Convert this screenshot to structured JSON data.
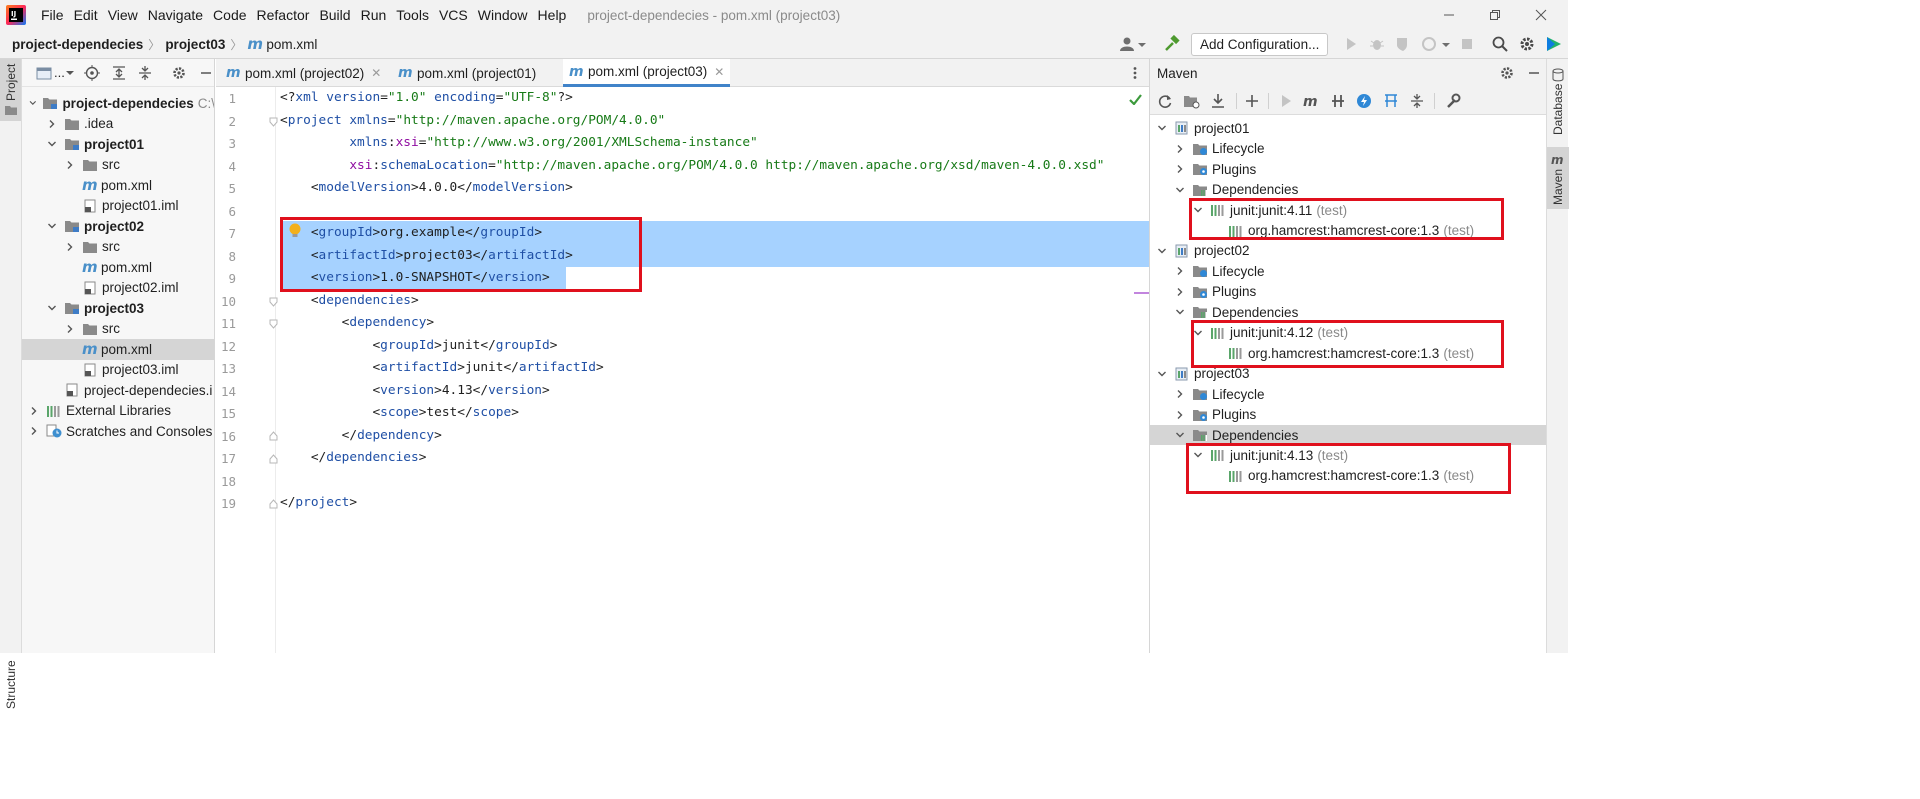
{
  "menubar": {
    "items": [
      "File",
      "Edit",
      "View",
      "Navigate",
      "Code",
      "Refactor",
      "Build",
      "Run",
      "Tools",
      "VCS",
      "Window",
      "Help"
    ],
    "window_title": "project-dependecies - pom.xml (project03)"
  },
  "navbar": {
    "crumbs": [
      "project-dependecies",
      "project03",
      "pom.xml"
    ],
    "run_config_label": "Add Configuration..."
  },
  "left_stripe": {
    "project_label": "Project",
    "structure_label": "Structure"
  },
  "project_panel": {
    "header_label": "...",
    "tree": [
      {
        "label": "project-dependecies",
        "hint": "C:\\",
        "bold": true,
        "level": 0,
        "arrow": "down",
        "icon": "module-folder"
      },
      {
        "label": ".idea",
        "level": 1,
        "arrow": "right",
        "icon": "folder"
      },
      {
        "label": "project01",
        "bold": true,
        "level": 1,
        "arrow": "down",
        "icon": "module-folder"
      },
      {
        "label": "src",
        "level": 2,
        "arrow": "right",
        "icon": "folder"
      },
      {
        "label": "pom.xml",
        "level": 2,
        "arrow": "none",
        "icon": "maven-m"
      },
      {
        "label": "project01.iml",
        "level": 2,
        "arrow": "none",
        "icon": "iml-file"
      },
      {
        "label": "project02",
        "bold": true,
        "level": 1,
        "arrow": "down",
        "icon": "module-folder"
      },
      {
        "label": "src",
        "level": 2,
        "arrow": "right",
        "icon": "folder"
      },
      {
        "label": "pom.xml",
        "level": 2,
        "arrow": "none",
        "icon": "maven-m"
      },
      {
        "label": "project02.iml",
        "level": 2,
        "arrow": "none",
        "icon": "iml-file"
      },
      {
        "label": "project03",
        "bold": true,
        "level": 1,
        "arrow": "down",
        "icon": "module-folder"
      },
      {
        "label": "src",
        "level": 2,
        "arrow": "right",
        "icon": "folder"
      },
      {
        "label": "pom.xml",
        "level": 2,
        "arrow": "none",
        "icon": "maven-m",
        "selected": true
      },
      {
        "label": "project03.iml",
        "level": 2,
        "arrow": "none",
        "icon": "iml-file"
      },
      {
        "label": "project-dependecies.i",
        "level": 1,
        "arrow": "none",
        "icon": "iml-file"
      },
      {
        "label": "External Libraries",
        "level": 0,
        "arrow": "right",
        "icon": "library"
      },
      {
        "label": "Scratches and Consoles",
        "level": 0,
        "arrow": "right",
        "icon": "scratch"
      }
    ]
  },
  "editor": {
    "tabs": [
      {
        "label": "pom.xml (project02)",
        "active": false
      },
      {
        "label": "pom.xml (project01)",
        "active": false
      },
      {
        "label": "pom.xml (project03)",
        "active": true
      }
    ],
    "line_numbers": [
      "1",
      "2",
      "3",
      "4",
      "5",
      "6",
      "7",
      "8",
      "9",
      "10",
      "11",
      "12",
      "13",
      "14",
      "15",
      "16",
      "17",
      "18",
      "19"
    ],
    "lines": [
      [
        [
          "br",
          "<?"
        ],
        [
          "tag",
          "xml "
        ],
        [
          "attr",
          "version"
        ],
        [
          "br",
          "="
        ],
        [
          "val",
          "\"1.0\" "
        ],
        [
          "attr",
          "encoding"
        ],
        [
          "br",
          "="
        ],
        [
          "val",
          "\"UTF-8\""
        ],
        [
          "br",
          "?>"
        ]
      ],
      [
        [
          "br",
          "<"
        ],
        [
          "tag",
          "project "
        ],
        [
          "attr",
          "xmlns"
        ],
        [
          "br",
          "="
        ],
        [
          "val",
          "\"http://maven.apache.org/POM/4.0.0\""
        ]
      ],
      [
        [
          "txt",
          "         "
        ],
        [
          "attr",
          "xmlns"
        ],
        [
          "br",
          ":"
        ],
        [
          "ns",
          "xsi"
        ],
        [
          "br",
          "="
        ],
        [
          "val",
          "\"http://www.w3.org/2001/XMLSchema-instance\""
        ]
      ],
      [
        [
          "txt",
          "         "
        ],
        [
          "ns",
          "xsi"
        ],
        [
          "br",
          ":"
        ],
        [
          "attr",
          "schemaLocation"
        ],
        [
          "br",
          "="
        ],
        [
          "val",
          "\"http://maven.apache.org/POM/4.0.0 http://maven.apache.org/xsd/maven-4.0.0.xsd\""
        ]
      ],
      [
        [
          "txt",
          "    "
        ],
        [
          "br",
          "<"
        ],
        [
          "tag",
          "modelVersion"
        ],
        [
          "br",
          ">"
        ],
        [
          "txt",
          "4.0.0"
        ],
        [
          "br",
          "</"
        ],
        [
          "tag",
          "modelVersion"
        ],
        [
          "br",
          ">"
        ]
      ],
      [],
      [
        [
          "txt",
          "    "
        ],
        [
          "br",
          "<"
        ],
        [
          "tag",
          "groupId"
        ],
        [
          "br",
          ">"
        ],
        [
          "txt",
          "org.example"
        ],
        [
          "br",
          "</"
        ],
        [
          "tag",
          "groupId"
        ],
        [
          "br",
          ">"
        ]
      ],
      [
        [
          "txt",
          "    "
        ],
        [
          "br",
          "<"
        ],
        [
          "tag",
          "artifactId"
        ],
        [
          "br",
          ">"
        ],
        [
          "txt",
          "project03"
        ],
        [
          "br",
          "</"
        ],
        [
          "tag",
          "artifactId"
        ],
        [
          "br",
          ">"
        ]
      ],
      [
        [
          "txt",
          "    "
        ],
        [
          "br",
          "<"
        ],
        [
          "tag",
          "version"
        ],
        [
          "br",
          ">"
        ],
        [
          "txt",
          "1.0-SNAPSHOT"
        ],
        [
          "br",
          "</"
        ],
        [
          "tag",
          "version"
        ],
        [
          "br",
          ">"
        ]
      ],
      [
        [
          "txt",
          "    "
        ],
        [
          "br",
          "<"
        ],
        [
          "tag",
          "dependencies"
        ],
        [
          "br",
          ">"
        ]
      ],
      [
        [
          "txt",
          "        "
        ],
        [
          "br",
          "<"
        ],
        [
          "tag",
          "dependency"
        ],
        [
          "br",
          ">"
        ]
      ],
      [
        [
          "txt",
          "            "
        ],
        [
          "br",
          "<"
        ],
        [
          "tag",
          "groupId"
        ],
        [
          "br",
          ">"
        ],
        [
          "txt",
          "junit"
        ],
        [
          "br",
          "</"
        ],
        [
          "tag",
          "groupId"
        ],
        [
          "br",
          ">"
        ]
      ],
      [
        [
          "txt",
          "            "
        ],
        [
          "br",
          "<"
        ],
        [
          "tag",
          "artifactId"
        ],
        [
          "br",
          ">"
        ],
        [
          "txt",
          "junit"
        ],
        [
          "br",
          "</"
        ],
        [
          "tag",
          "artifactId"
        ],
        [
          "br",
          ">"
        ]
      ],
      [
        [
          "txt",
          "            "
        ],
        [
          "br",
          "<"
        ],
        [
          "tag",
          "version"
        ],
        [
          "br",
          ">"
        ],
        [
          "txt",
          "4.13"
        ],
        [
          "br",
          "</"
        ],
        [
          "tag",
          "version"
        ],
        [
          "br",
          ">"
        ]
      ],
      [
        [
          "txt",
          "            "
        ],
        [
          "br",
          "<"
        ],
        [
          "tag",
          "scope"
        ],
        [
          "br",
          ">"
        ],
        [
          "txt",
          "test"
        ],
        [
          "br",
          "</"
        ],
        [
          "tag",
          "scope"
        ],
        [
          "br",
          ">"
        ]
      ],
      [
        [
          "txt",
          "        "
        ],
        [
          "br",
          "</"
        ],
        [
          "tag",
          "dependency"
        ],
        [
          "br",
          ">"
        ]
      ],
      [
        [
          "txt",
          "    "
        ],
        [
          "br",
          "</"
        ],
        [
          "tag",
          "dependencies"
        ],
        [
          "br",
          ">"
        ]
      ],
      [],
      [
        [
          "br",
          "</"
        ],
        [
          "tag",
          "project"
        ],
        [
          "br",
          ">"
        ]
      ]
    ]
  },
  "maven": {
    "title": "Maven",
    "tree": [
      {
        "label": "project01",
        "level": 0,
        "arrow": "down",
        "icon": "maven-module"
      },
      {
        "label": "Lifecycle",
        "level": 1,
        "arrow": "right",
        "icon": "lifecycle"
      },
      {
        "label": "Plugins",
        "level": 1,
        "arrow": "right",
        "icon": "plugins"
      },
      {
        "label": "Dependencies",
        "level": 1,
        "arrow": "down",
        "icon": "deps"
      },
      {
        "label": "junit:junit:4.11",
        "scope": "(test)",
        "level": 2,
        "arrow": "down",
        "icon": "lib"
      },
      {
        "label": "org.hamcrest:hamcrest-core:1.3",
        "scope": "(test)",
        "level": 3,
        "arrow": "none",
        "icon": "lib"
      },
      {
        "label": "project02",
        "level": 0,
        "arrow": "down",
        "icon": "maven-module"
      },
      {
        "label": "Lifecycle",
        "level": 1,
        "arrow": "right",
        "icon": "lifecycle"
      },
      {
        "label": "Plugins",
        "level": 1,
        "arrow": "right",
        "icon": "plugins"
      },
      {
        "label": "Dependencies",
        "level": 1,
        "arrow": "down",
        "icon": "deps"
      },
      {
        "label": "junit:junit:4.12",
        "scope": "(test)",
        "level": 2,
        "arrow": "down",
        "icon": "lib"
      },
      {
        "label": "org.hamcrest:hamcrest-core:1.3",
        "scope": "(test)",
        "level": 3,
        "arrow": "none",
        "icon": "lib"
      },
      {
        "label": "project03",
        "level": 0,
        "arrow": "down",
        "icon": "maven-module"
      },
      {
        "label": "Lifecycle",
        "level": 1,
        "arrow": "right",
        "icon": "lifecycle"
      },
      {
        "label": "Plugins",
        "level": 1,
        "arrow": "right",
        "icon": "plugins"
      },
      {
        "label": "Dependencies",
        "level": 1,
        "arrow": "down",
        "icon": "deps",
        "selected": true
      },
      {
        "label": "junit:junit:4.13",
        "scope": "(test)",
        "level": 2,
        "arrow": "down",
        "icon": "lib"
      },
      {
        "label": "org.hamcrest:hamcrest-core:1.3",
        "scope": "(test)",
        "level": 3,
        "arrow": "none",
        "icon": "lib"
      }
    ]
  },
  "right_stripe": {
    "database_label": "Database",
    "maven_label": "Maven"
  },
  "colors": {
    "selection": "#a6d2ff",
    "highlight_box": "#e0101d",
    "accent": "#4083c9"
  }
}
